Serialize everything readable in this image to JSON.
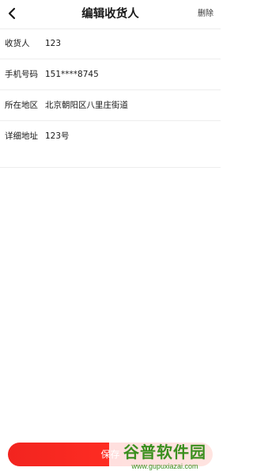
{
  "header": {
    "title": "编辑收货人",
    "delete_label": "删除"
  },
  "form": {
    "rows": [
      {
        "label": "收货人",
        "value": "123"
      },
      {
        "label": "手机号码",
        "value": "151****8745"
      },
      {
        "label": "所在地区",
        "value": "北京朝阳区八里庄街道"
      },
      {
        "label": "详细地址",
        "value": "123号"
      }
    ]
  },
  "footer": {
    "save_label": "保存"
  },
  "watermark": {
    "text": "谷普软件园",
    "url": "www.gupuxiazai.com"
  },
  "colors": {
    "accent": "#f2241f",
    "watermark": "#3a8f1e"
  },
  "icons": {
    "back": "chevron-left-icon"
  }
}
